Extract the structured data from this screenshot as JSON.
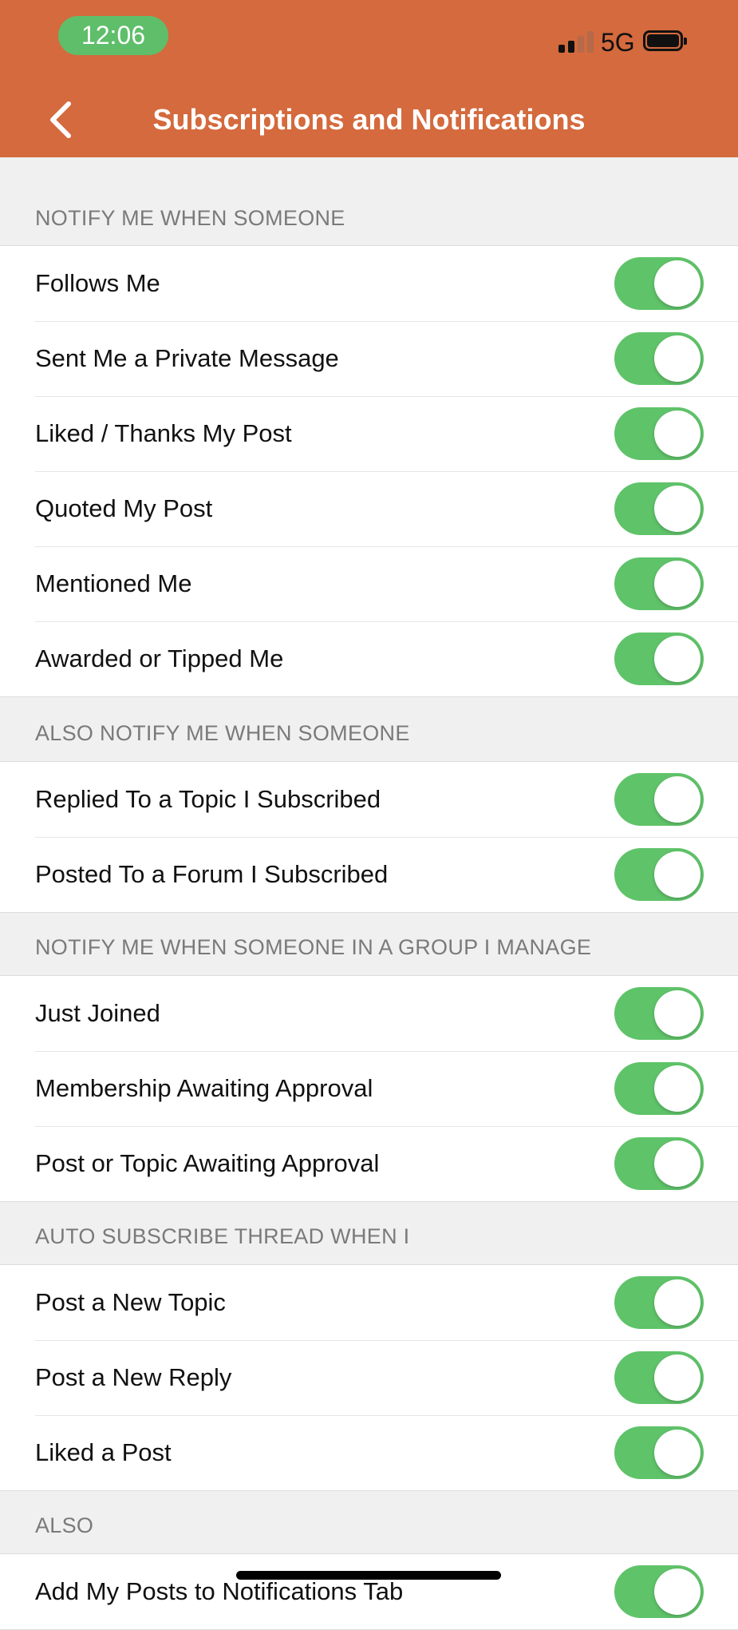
{
  "status_bar": {
    "time": "12:06",
    "network": "5G",
    "signal_bars_active": 2,
    "battery_level": 1
  },
  "nav": {
    "back_icon": "chevron-left-icon",
    "title": "Subscriptions and Notifications"
  },
  "colors": {
    "header_bg": "#d46a3d",
    "toggle_on": "#5fc369",
    "time_pill": "#5fbe6a"
  },
  "sections": [
    {
      "header": "NOTIFY ME WHEN SOMEONE",
      "items": [
        {
          "label": "Follows Me",
          "enabled": true
        },
        {
          "label": "Sent Me a Private Message",
          "enabled": true
        },
        {
          "label": "Liked / Thanks My Post",
          "enabled": true
        },
        {
          "label": "Quoted My Post",
          "enabled": true
        },
        {
          "label": "Mentioned Me",
          "enabled": true
        },
        {
          "label": "Awarded or Tipped Me",
          "enabled": true
        }
      ]
    },
    {
      "header": "ALSO NOTIFY ME WHEN SOMEONE",
      "items": [
        {
          "label": "Replied To a Topic I Subscribed",
          "enabled": true
        },
        {
          "label": "Posted To a Forum I Subscribed",
          "enabled": true
        }
      ]
    },
    {
      "header": "NOTIFY ME WHEN SOMEONE IN A GROUP I MANAGE",
      "items": [
        {
          "label": "Just Joined",
          "enabled": true
        },
        {
          "label": "Membership Awaiting Approval",
          "enabled": true
        },
        {
          "label": "Post or Topic Awaiting Approval",
          "enabled": true
        }
      ]
    },
    {
      "header": "AUTO SUBSCRIBE THREAD WHEN I",
      "items": [
        {
          "label": "Post a New Topic",
          "enabled": true
        },
        {
          "label": "Post a New Reply",
          "enabled": true
        },
        {
          "label": "Liked a Post",
          "enabled": true
        }
      ]
    },
    {
      "header": "ALSO",
      "items": [
        {
          "label": "Add My Posts to Notifications Tab",
          "enabled": true
        }
      ]
    }
  ]
}
